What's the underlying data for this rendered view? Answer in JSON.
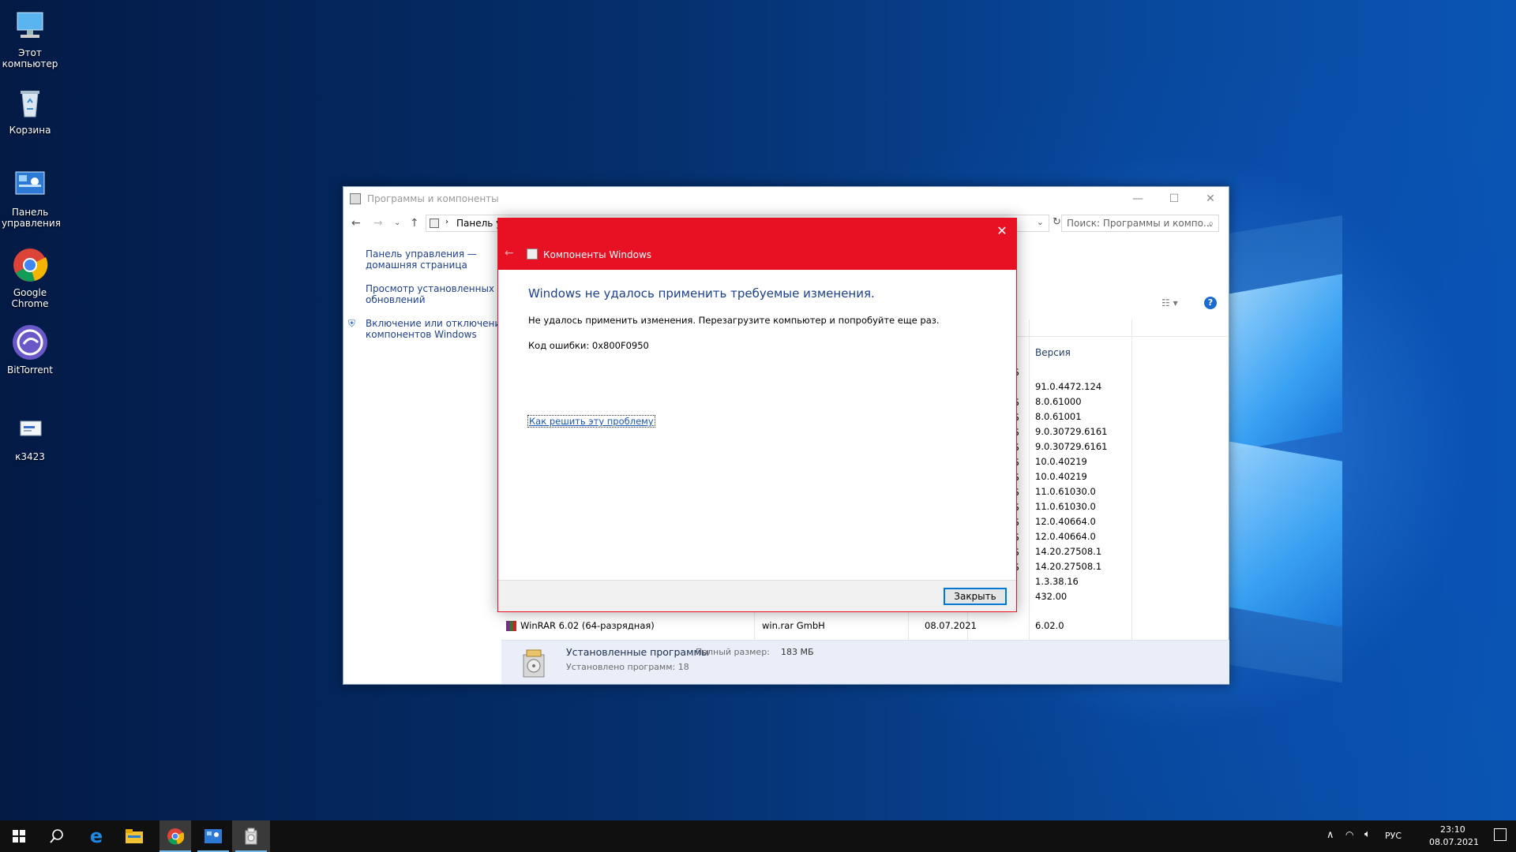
{
  "desktop": {
    "icons": [
      {
        "label": "Этот\nкомпьютер"
      },
      {
        "label": "Корзина"
      },
      {
        "label": "Панель\nуправления"
      },
      {
        "label": "Google\nChrome"
      },
      {
        "label": "BitTorrent"
      },
      {
        "label": "к3423"
      }
    ]
  },
  "window": {
    "title": "Программы и компоненты",
    "breadcrumb": "Панель у",
    "search_placeholder": "Поиск: Программы и компо...",
    "nav": [
      "Панель управления —\nдомашняя страница",
      "Просмотр установленных\nобновлений",
      "Включение или отключение\nкомпонентов Windows"
    ],
    "version_header": "Версия",
    "size_suffix": "Б",
    "versions": [
      "91.0.4472.124",
      "8.0.61000",
      "8.0.61001",
      "9.0.30729.6161",
      "9.0.30729.6161",
      "10.0.40219",
      "10.0.40219",
      "11.0.61030.0",
      "11.0.61030.0",
      "12.0.40664.0",
      "12.0.40664.0",
      "14.20.27508.1",
      "14.20.27508.1",
      "1.3.38.16",
      "432.00"
    ],
    "last_row": {
      "name": "WinRAR 6.02 (64-разрядная)",
      "publisher": "win.rar GmbH",
      "date": "08.07.2021",
      "version": "6.02.0"
    },
    "status": {
      "title": "Установленные программы",
      "size_label": "Полный размер:",
      "size_value": "183 МБ",
      "count": "Установлено программ: 18"
    }
  },
  "dialog": {
    "title": "Компоненты Windows",
    "heading": "Windows не удалось применить требуемые изменения.",
    "message": "Не удалось применить изменения. Перезагрузите компьютер и попробуйте еще раз.",
    "error_code": "Код ошибки: 0x800F0950",
    "help_link": "Как решить эту проблему",
    "close_button": "Закрыть"
  },
  "taskbar": {
    "language": "РУС",
    "time": "23:10",
    "date": "08.07.2021"
  },
  "colors": {
    "accent_red": "#e81123",
    "link_blue": "#1a57b6",
    "heading_blue": "#1b3f8f"
  }
}
